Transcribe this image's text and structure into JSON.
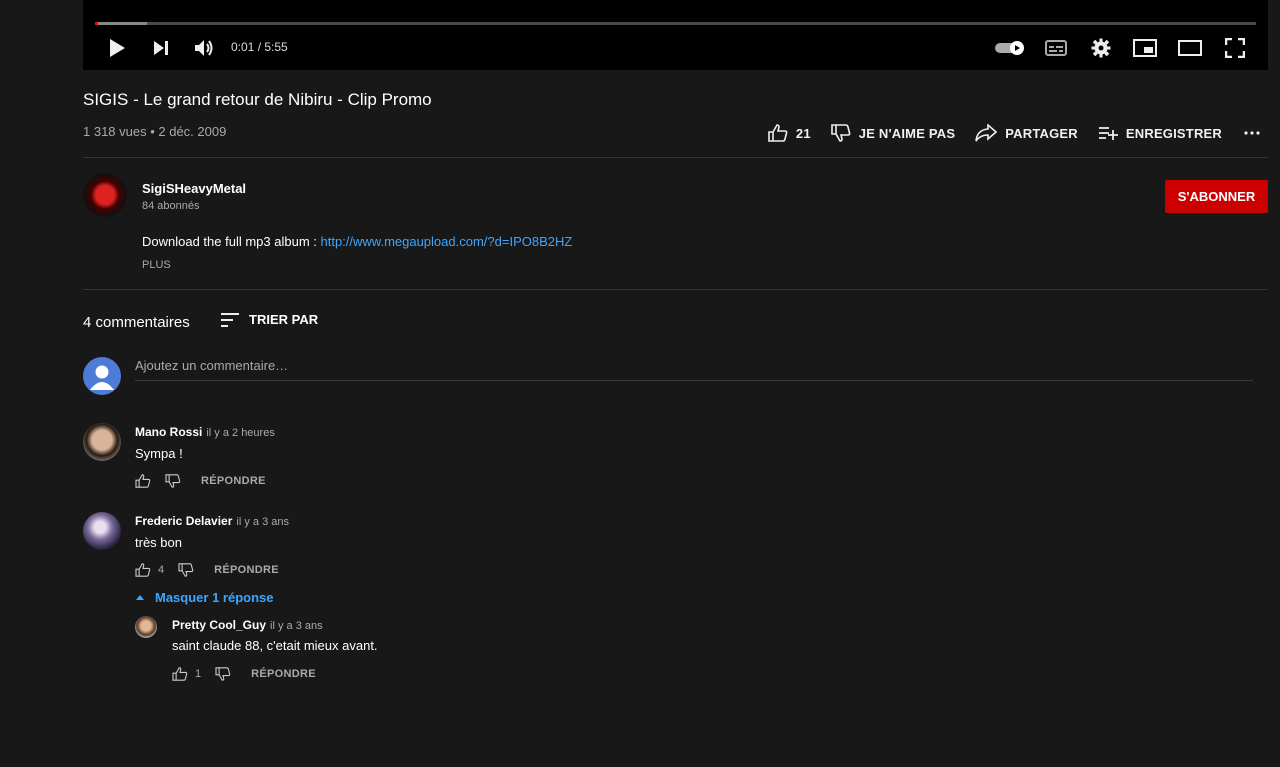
{
  "player": {
    "time": "0:01 / 5:55",
    "progress_played": 0.003
  },
  "video": {
    "title": "SIGIS - Le grand retour de Nibiru - Clip Promo",
    "meta": "1 318 vues • 2 déc. 2009",
    "like_count": "21",
    "dislike_label": "JE N'AIME PAS",
    "share_label": "PARTAGER",
    "save_label": "ENREGISTRER"
  },
  "channel": {
    "name": "SigiSHeavyMetal",
    "subscribers": "84 abonnés",
    "subscribe_label": "S'ABONNER",
    "description_prefix": "Download the full mp3 album : ",
    "description_link": "http://www.megaupload.com/?d=IPO8B2HZ",
    "more_label": "PLUS"
  },
  "comments": {
    "count_label": "4 commentaires",
    "sort_label": "TRIER PAR",
    "add_placeholder": "Ajoutez un commentaire…",
    "items": [
      {
        "author": "Mano Rossi",
        "time": "il y a 2 heures",
        "text": "Sympa !",
        "likes": "",
        "reply_label": "RÉPONDRE"
      },
      {
        "author": "Frederic Delavier",
        "time": "il y a 3 ans",
        "text": "très bon",
        "likes": "4",
        "reply_label": "RÉPONDRE"
      }
    ],
    "hide_replies_label": "Masquer 1 réponse",
    "reply": {
      "author": "Pretty Cool_Guy",
      "time": "il y a 3 ans",
      "text": "saint claude 88, c'etait mieux avant.",
      "likes": "1",
      "reply_label": "RÉPONDRE"
    }
  },
  "colors": {
    "background": "#181818",
    "accent_red": "#cc0000",
    "link_blue": "#3ea6ff"
  }
}
